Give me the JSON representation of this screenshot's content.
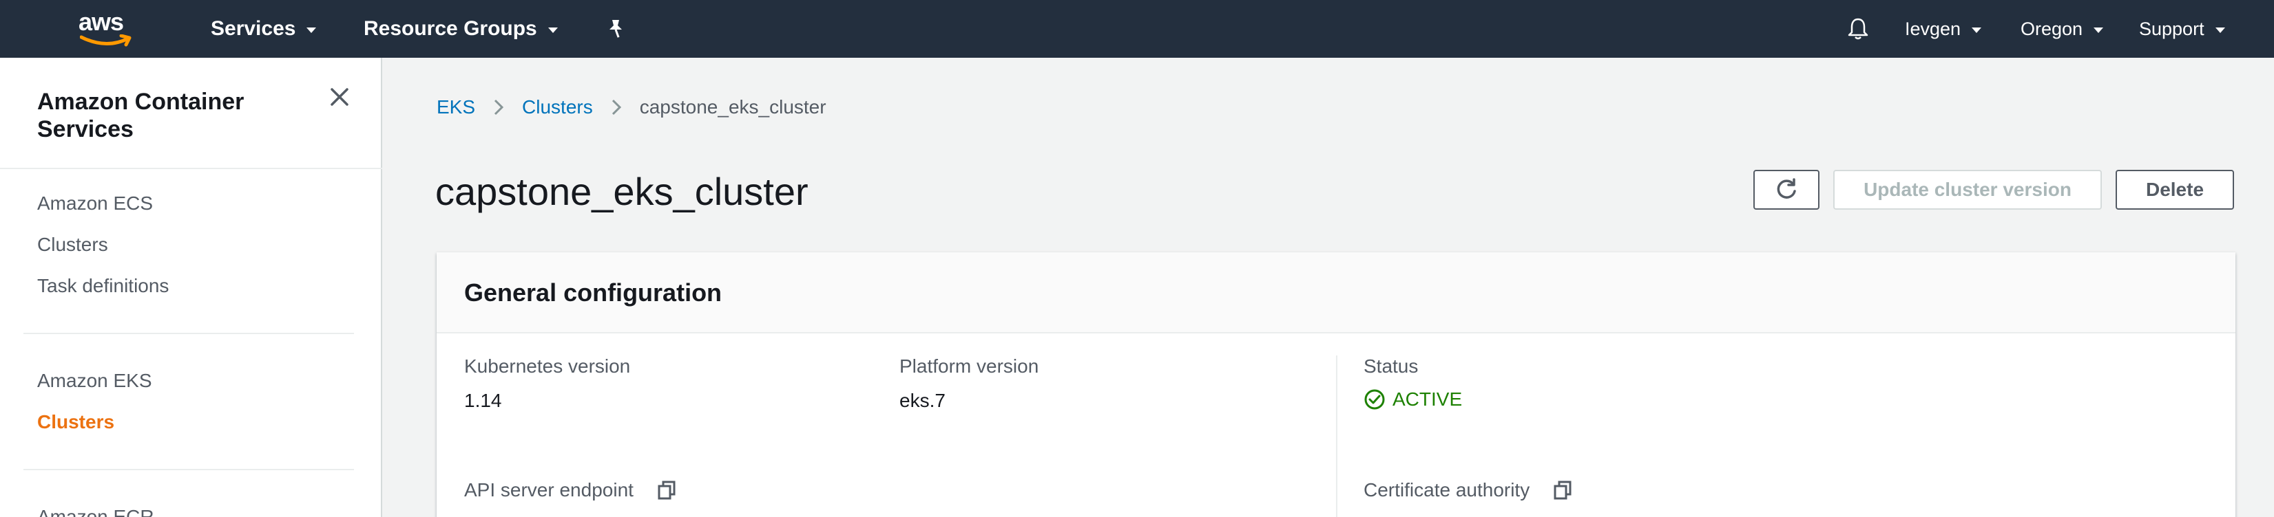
{
  "topnav": {
    "logo_text": "aws",
    "services_label": "Services",
    "resource_groups_label": "Resource Groups",
    "pin_icon": "pin-icon",
    "bell_icon": "bell-icon",
    "user_label": "Ievgen",
    "region_label": "Oregon",
    "support_label": "Support",
    "background_color": "#232f3e"
  },
  "sidebar": {
    "title": "Amazon Container Services",
    "close_icon": "close-icon",
    "sections": [
      {
        "header": "Amazon ECS",
        "items": [
          "Clusters",
          "Task definitions"
        ]
      },
      {
        "header": "Amazon EKS",
        "items": [
          "Clusters"
        ],
        "active_item": "Clusters"
      },
      {
        "header": "Amazon ECR",
        "items": []
      }
    ],
    "active_color": "#ec7211"
  },
  "breadcrumb": {
    "items": [
      "EKS",
      "Clusters",
      "capstone_eks_cluster"
    ]
  },
  "page": {
    "title": "capstone_eks_cluster",
    "refresh_icon": "refresh-icon",
    "update_button": "Update cluster version",
    "delete_button": "Delete"
  },
  "general_config": {
    "title": "General configuration",
    "kubernetes_version_label": "Kubernetes version",
    "kubernetes_version_value": "1.14",
    "platform_version_label": "Platform version",
    "platform_version_value": "eks.7",
    "status_label": "Status",
    "status_value": "ACTIVE",
    "status_color": "#1d8102",
    "api_endpoint_label": "API server endpoint",
    "cert_authority_label": "Certificate authority"
  },
  "colors": {
    "link": "#0073bb",
    "page_background": "#f2f3f3"
  }
}
